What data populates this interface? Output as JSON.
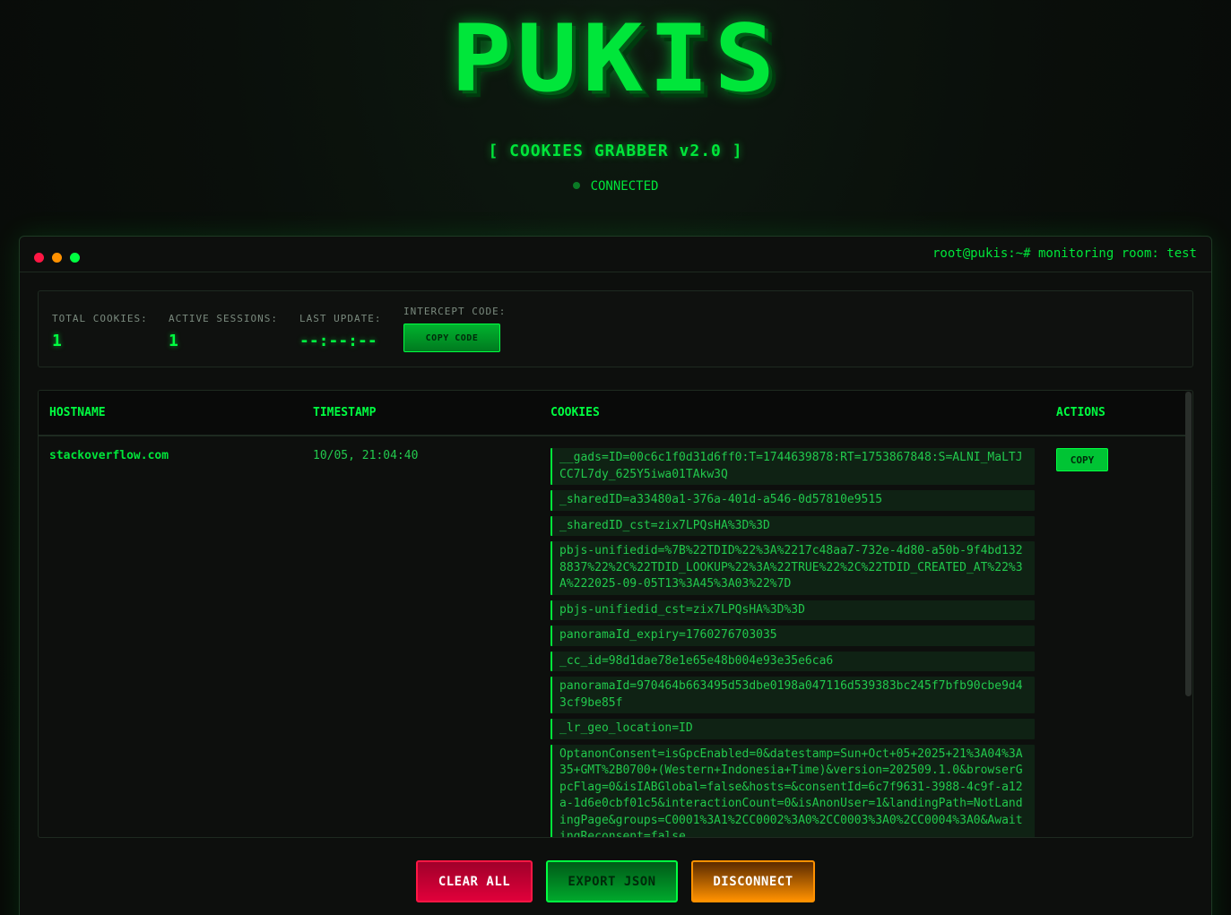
{
  "header": {
    "logo": "PUKIS",
    "subtitle": "[ COOKIES GRABBER v2.0 ]",
    "status": "CONNECTED"
  },
  "window": {
    "prompt": "root@pukis:~# monitoring room: test"
  },
  "stats": {
    "total_label": "TOTAL COOKIES:",
    "total_value": "1",
    "sessions_label": "ACTIVE SESSIONS:",
    "sessions_value": "1",
    "update_label": "LAST UPDATE:",
    "update_value": "--:--:--",
    "intercept_label": "INTERCEPT CODE:",
    "copy_code_label": "COPY CODE"
  },
  "table": {
    "headers": [
      "HOSTNAME",
      "TIMESTAMP",
      "COOKIES",
      "ACTIONS"
    ],
    "rows": [
      {
        "hostname": "stackoverflow.com",
        "timestamp": "10/05, 21:04:40",
        "copy_label": "COPY",
        "cookies": [
          "__gads=ID=00c6c1f0d31d6ff0:T=1744639878:RT=1753867848:S=ALNI_MaLTJCC7L7dy_625Y5iwa01TAkw3Q",
          "_sharedID=a33480a1-376a-401d-a546-0d57810e9515",
          "_sharedID_cst=zix7LPQsHA%3D%3D",
          "pbjs-unifiedid=%7B%22TDID%22%3A%2217c48aa7-732e-4d80-a50b-9f4bd1328837%22%2C%22TDID_LOOKUP%22%3A%22TRUE%22%2C%22TDID_CREATED_AT%22%3A%222025-09-05T13%3A45%3A03%22%7D",
          "pbjs-unifiedid_cst=zix7LPQsHA%3D%3D",
          "panoramaId_expiry=1760276703035",
          "_cc_id=98d1dae78e1e65e48b004e93e35e6ca6",
          "panoramaId=970464b663495d53dbe0198a047116d539383bc245f7bfb90cbe9d43cf9be85f",
          "_lr_geo_location=ID",
          "OptanonConsent=isGpcEnabled=0&datestamp=Sun+Oct+05+2025+21%3A04%3A35+GMT%2B0700+(Western+Indonesia+Time)&version=202509.1.0&browserGpcFlag=0&isIABGlobal=false&hosts=&consentId=6c7f9631-3988-4c9f-a12a-1d6e0cbf01c5&interactionCount=0&isAnonUser=1&landingPath=NotLandingPage&groups=C0001%3A1%2CC0002%3A0%2CC0003%3A0%2CC0004%3A0&AwaitingReconsent=false"
        ]
      }
    ]
  },
  "actions": {
    "clear": "CLEAR ALL",
    "export": "EXPORT JSON",
    "disconnect": "DISCONNECT"
  },
  "colors": {
    "accent": "#00ff41",
    "danger": "#ff1744",
    "warning": "#ff9100",
    "background": "#0a0f0b"
  }
}
